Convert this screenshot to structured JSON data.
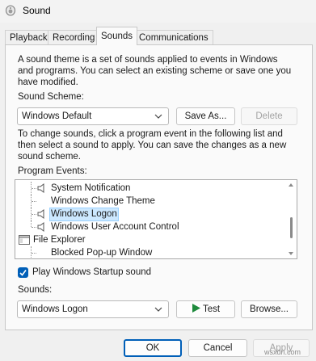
{
  "window": {
    "title": "Sound",
    "icon": "speaker-app-icon"
  },
  "tabs": [
    {
      "label": "Playback"
    },
    {
      "label": "Recording"
    },
    {
      "label": "Sounds"
    },
    {
      "label": "Communications"
    }
  ],
  "sounds_tab": {
    "intro": [
      "A sound theme is a set of sounds applied to events in Windows",
      "and programs.  You can select an existing scheme or save one you",
      "have modified."
    ],
    "scheme_label": "Sound Scheme:",
    "scheme_value": "Windows Default",
    "save_as_label": "Save As...",
    "delete_label": "Delete",
    "instructions": [
      "To change sounds, click a program event in the following list and",
      "then select a sound to apply.  You can save the changes as a new",
      "sound scheme."
    ],
    "events_label": "Program Events:",
    "events": [
      {
        "label": "System Notification",
        "type": "item"
      },
      {
        "label": "Windows Change Theme",
        "type": "item-nosound"
      },
      {
        "label": "Windows Logon",
        "type": "item",
        "selected": true
      },
      {
        "label": "Windows User Account Control",
        "type": "item"
      },
      {
        "label": "File Explorer",
        "type": "group"
      },
      {
        "label": "Blocked Pop-up Window",
        "type": "item-nosound"
      }
    ],
    "startup_checkbox_label": "Play Windows Startup sound",
    "startup_checked": true,
    "sounds_label": "Sounds:",
    "sound_value": "Windows Logon",
    "test_label": "Test",
    "browse_label": "Browse..."
  },
  "footer": {
    "ok_label": "OK",
    "cancel_label": "Cancel",
    "apply_label": "Apply"
  },
  "watermark": "wsxdn.com",
  "colors": {
    "accent": "#005fb8",
    "selection": "#cce8ff",
    "disabled_text": "#a3a3a3"
  }
}
